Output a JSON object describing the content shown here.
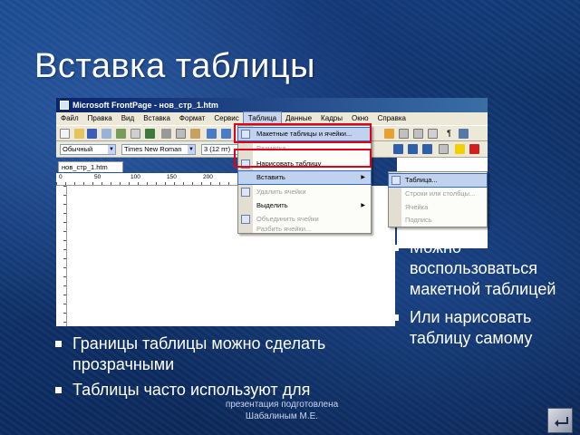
{
  "slide": {
    "title": "Вставка таблицы",
    "footer": "презентация подготовлена Шабалиным М.Е."
  },
  "screenshot": {
    "window_title": "Microsoft FrontPage - нов_стр_1.htm",
    "menu": [
      "Файл",
      "Правка",
      "Вид",
      "Вставка",
      "Формат",
      "Сервис",
      "Таблица",
      "Данные",
      "Кадры",
      "Окно",
      "Справка"
    ],
    "active_menu": "Таблица",
    "style_combo": "Обычный",
    "font_combo": "Times New Roman",
    "size_combo": "3 (12 пт)",
    "doc_tab": "нов_стр_1.htm",
    "ruler_ticks": [
      "0",
      "50",
      "100",
      "150",
      "200"
    ],
    "table_menu": {
      "items": [
        {
          "label": "Макетные таблицы и ячейки...",
          "state": "highlight"
        },
        {
          "label": "Разметка...",
          "state": "disabled"
        },
        {
          "label": "Нарисовать таблицу",
          "state": "normal"
        },
        {
          "label": "Вставить",
          "state": "highlight",
          "submenu": true
        },
        {
          "label": "Удалить ячейки",
          "state": "disabled"
        },
        {
          "label": "Выделить",
          "state": "normal",
          "submenu": true
        },
        {
          "label": "Объединить ячейки",
          "state": "disabled"
        },
        {
          "label": "Разбить ячейки...",
          "state": "disabled"
        }
      ]
    },
    "insert_submenu": {
      "items": [
        {
          "label": "Таблица...",
          "state": "highlight"
        },
        {
          "label": "Строки или столбцы...",
          "state": "disabled"
        },
        {
          "label": "Ячейка",
          "state": "disabled"
        },
        {
          "label": "Подпись",
          "state": "disabled"
        }
      ]
    }
  },
  "bullets_right": [
    "Можно воспользоваться макетной таблицей",
    "Или нарисовать таблицу самому"
  ],
  "bullets_left": [
    "Границы таблицы можно сделать прозрачными",
    "Таблицы часто используют для"
  ],
  "colors": {
    "background": "#123a78",
    "highlight_box": "#e0001a",
    "title_bar": "#0a246a"
  },
  "icons": {
    "nav_button": "return-arrow-icon",
    "app_icon": "frontpage-icon"
  }
}
